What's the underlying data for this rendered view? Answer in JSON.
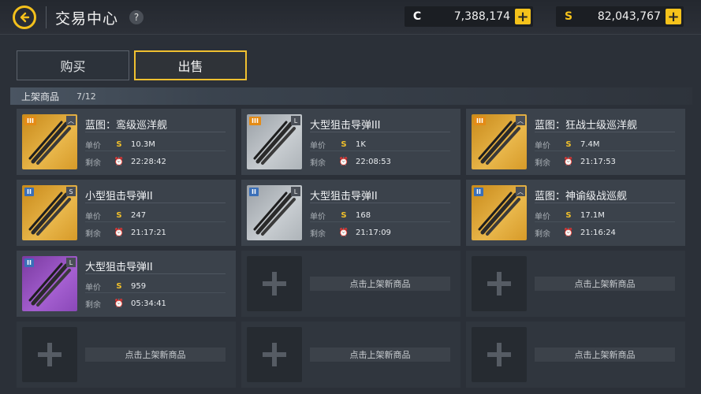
{
  "header": {
    "title": "交易中心",
    "help": "?",
    "currencies": [
      {
        "icon": "C",
        "value": "7,388,174",
        "plus": "+"
      },
      {
        "icon": "S",
        "value": "82,043,767",
        "plus": "+"
      }
    ]
  },
  "tabs": [
    {
      "label": "购买",
      "active": false
    },
    {
      "label": "出售",
      "active": true
    }
  ],
  "section": {
    "label": "上架商品",
    "count": "7/12"
  },
  "labels": {
    "price": "单价",
    "remaining": "剩余",
    "price_icon": "S",
    "timer_icon": "⏰"
  },
  "items": [
    {
      "name": "蓝图：鸾级巡洋舰",
      "tier": "III",
      "corner": "︿",
      "price": "10.3M",
      "time": "22:28:42",
      "thumb": "gold"
    },
    {
      "name": "大型狙击导弹III",
      "tier": "III",
      "corner": "L",
      "price": "1K",
      "time": "22:08:53",
      "thumb": "grey"
    },
    {
      "name": "蓝图：狂战士级巡洋舰",
      "tier": "III",
      "corner": "︿",
      "price": "7.4M",
      "time": "21:17:53",
      "thumb": "gold"
    },
    {
      "name": "小型狙击导弹II",
      "tier": "II",
      "corner": "S",
      "price": "247",
      "time": "21:17:21",
      "thumb": "gold"
    },
    {
      "name": "大型狙击导弹II",
      "tier": "II",
      "corner": "L",
      "price": "168",
      "time": "21:17:09",
      "thumb": "grey"
    },
    {
      "name": "蓝图：神谕级战巡舰",
      "tier": "II",
      "corner": "︿",
      "price": "17.1M",
      "time": "21:16:24",
      "thumb": "gold"
    },
    {
      "name": "大型狙击导弹II",
      "tier": "II",
      "corner": "L",
      "price": "959",
      "time": "05:34:41",
      "thumb": "purple"
    }
  ],
  "empty_slot_label": "点击上架新商品",
  "colors": {
    "accent": "#f5c21b",
    "card": "#3b424b",
    "background": "#2b3038"
  }
}
